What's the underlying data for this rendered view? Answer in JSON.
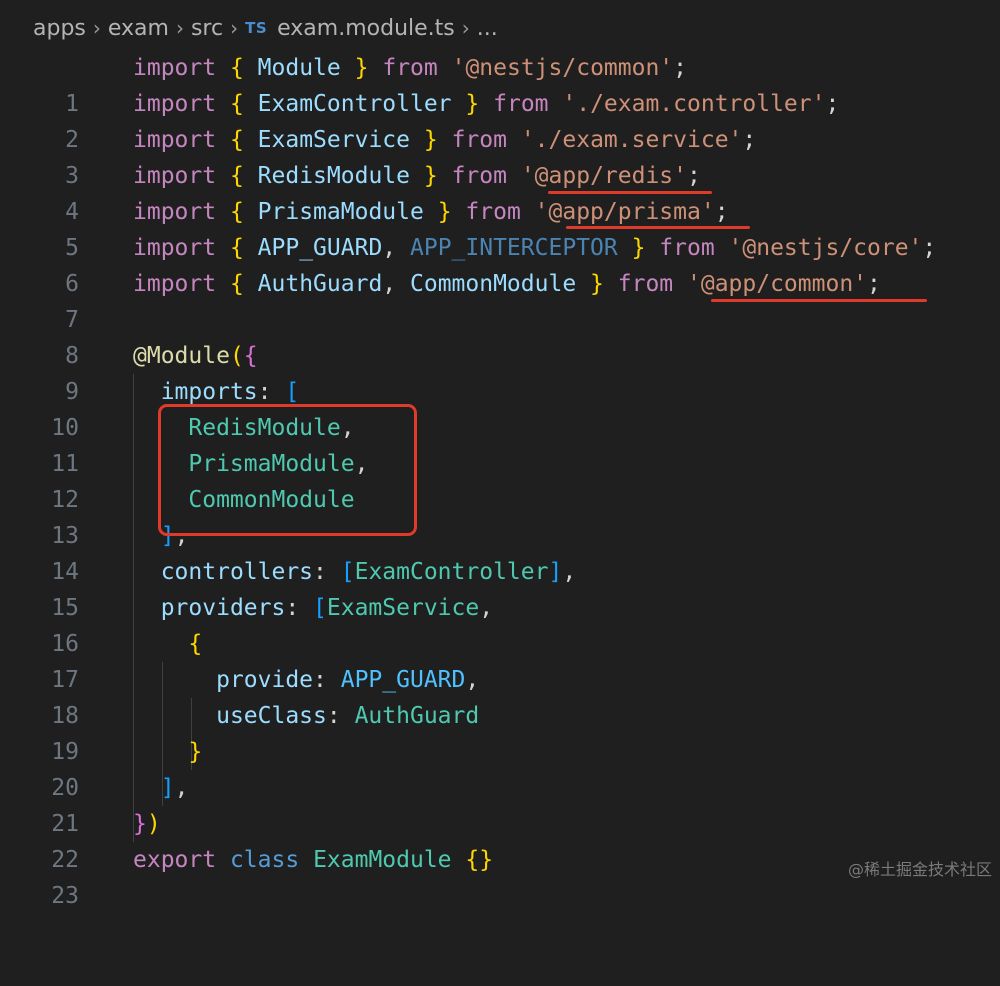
{
  "breadcrumb": {
    "parts": [
      "apps",
      "exam",
      "src"
    ],
    "file_icon": "TS",
    "file": "exam.module.ts",
    "ellipsis": "..."
  },
  "colors": {
    "keyword": "#c586c0",
    "string": "#ce9178",
    "type": "#4ec9b0",
    "variable": "#9cdcfe",
    "annotation_red": "#e03b2a"
  },
  "code": {
    "lines": [
      {
        "n": "1"
      },
      {
        "n": "2"
      },
      {
        "n": "3"
      },
      {
        "n": "4"
      },
      {
        "n": "5"
      },
      {
        "n": "6"
      },
      {
        "n": "7"
      },
      {
        "n": "8"
      },
      {
        "n": "9"
      },
      {
        "n": "10"
      },
      {
        "n": "11"
      },
      {
        "n": "12"
      },
      {
        "n": "13"
      },
      {
        "n": "14"
      },
      {
        "n": "15"
      },
      {
        "n": "16"
      },
      {
        "n": "17"
      },
      {
        "n": "18"
      },
      {
        "n": "19"
      },
      {
        "n": "20"
      },
      {
        "n": "21"
      },
      {
        "n": "22"
      },
      {
        "n": "23"
      }
    ],
    "t": {
      "import": "import",
      "from": "from",
      "export": "export",
      "class": "class",
      "Module": "Module",
      "ExamController": "ExamController",
      "ExamService": "ExamService",
      "RedisModule": "RedisModule",
      "PrismaModule": "PrismaModule",
      "APP_GUARD": "APP_GUARD",
      "APP_INTERCEPTOR": "APP_INTERCEPTOR",
      "AuthGuard": "AuthGuard",
      "CommonModule": "CommonModule",
      "ExamModule": "ExamModule",
      "s1": "'@nestjs/common'",
      "s2": "'./exam.controller'",
      "s3": "'./exam.service'",
      "s4": "'@app/redis'",
      "s5": "'@app/prisma'",
      "s6": "'@nestjs/core'",
      "s7": "'@app/common'",
      "decorator": "@Module",
      "imports": "imports",
      "controllers": "controllers",
      "providers": "providers",
      "provide": "provide",
      "useClass": "useClass"
    }
  },
  "watermark": "@稀土掘金技术社区"
}
